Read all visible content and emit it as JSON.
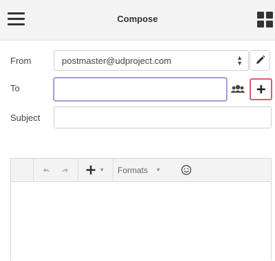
{
  "header": {
    "title": "Compose",
    "menu_icon": "hamburger-menu-icon",
    "apps_icon": "grid-apps-icon"
  },
  "form": {
    "from_label": "From",
    "from_value": "postmaster@udproject.com",
    "to_label": "To",
    "to_value": "",
    "subject_label": "Subject",
    "subject_value": ""
  },
  "toolbar": {
    "formats_label": "Formats",
    "icons": [
      "undo-icon",
      "redo-icon",
      "insert-plus-icon",
      "emoji-icon"
    ]
  },
  "colors": {
    "header_bg": "#f4f4f4",
    "to_focus_border": "#8c86c8",
    "highlight_border": "#e05a6a"
  }
}
